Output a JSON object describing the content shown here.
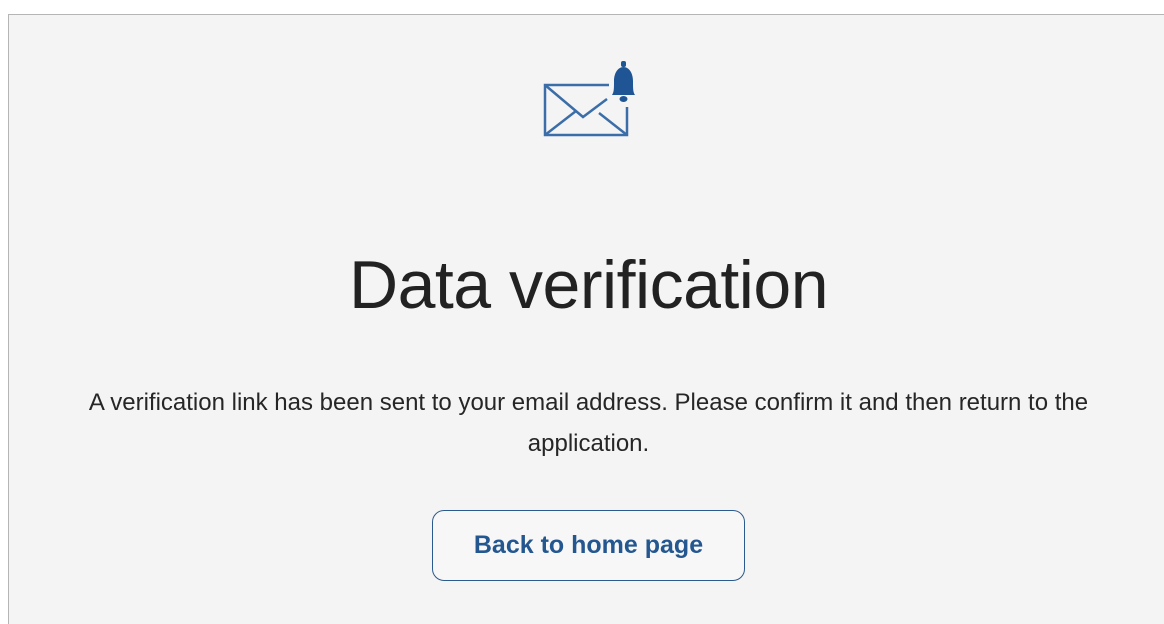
{
  "page": {
    "title": "Data verification",
    "message": "A verification link has been sent to your email address. Please confirm it and then return to the application.",
    "back_button_label": "Back to home page"
  },
  "icons": {
    "header_icon": "envelope-bell-icon"
  },
  "colors": {
    "accent": "#2a5a8e",
    "title_text": "#222222",
    "background": "#f4f4f4"
  }
}
